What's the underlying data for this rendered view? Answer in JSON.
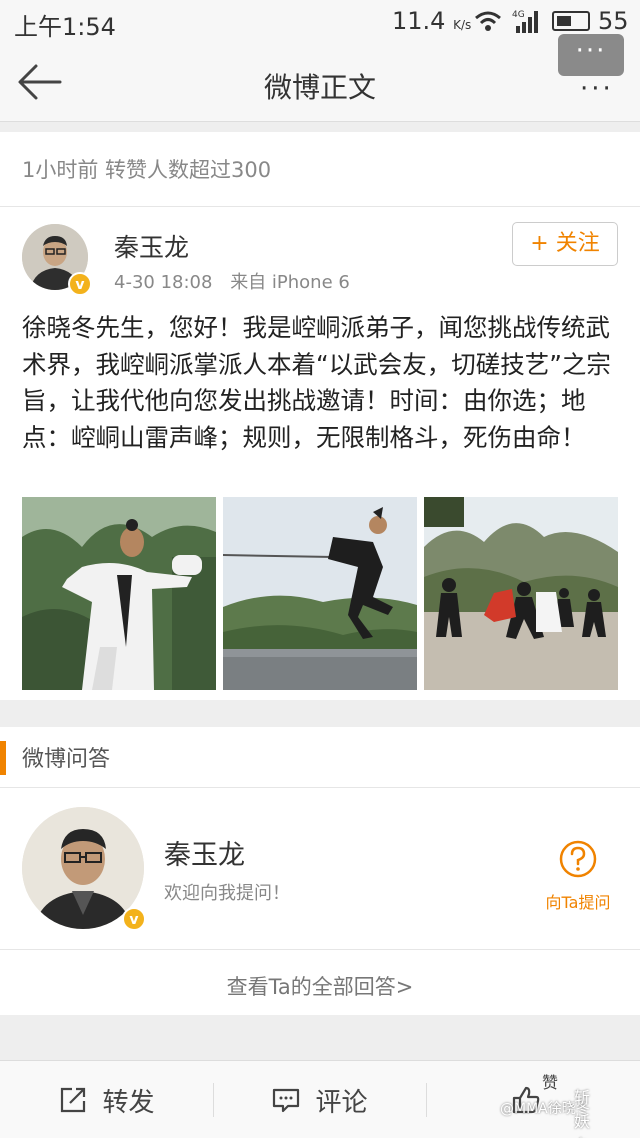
{
  "status_bar": {
    "time": "上午1:54",
    "speed": "11.4",
    "speed_unit": "K/s",
    "network": "4G",
    "battery": "55"
  },
  "nav": {
    "title": "微博正文",
    "more_badge": "···",
    "more_dots": "···"
  },
  "post": {
    "meta_line": "1小时前 转赞人数超过300",
    "author": "秦玉龙",
    "date": "4-30 18:08",
    "source": "来自 iPhone 6",
    "follow_label": "+ 关注",
    "verified_mark": "v",
    "text": "徐晓冬先生，您好！我是崆峒派弟子，闻您挑战传统武术界，我崆峒派掌派人本着“以武会友，切磋技艺”之宗旨，让我代他向您发出挑战邀请！时间：由你选；地点：崆峒山雷声峰；规则，无限制格斗，死伤由命！"
  },
  "qa": {
    "section_title": "微博问答",
    "name": "秦玉龙",
    "welcome": "欢迎向我提问！",
    "ask_label": "向Ta提问",
    "view_all": "查看Ta的全部回答>"
  },
  "toolbar": {
    "repost": "转发",
    "comment": "评论",
    "like": "赞"
  },
  "watermark": {
    "text": "@MMA徐晓冬",
    "brand": "斩妖台"
  },
  "colors": {
    "accent": "#f08300",
    "verified": "#f3b21c"
  }
}
